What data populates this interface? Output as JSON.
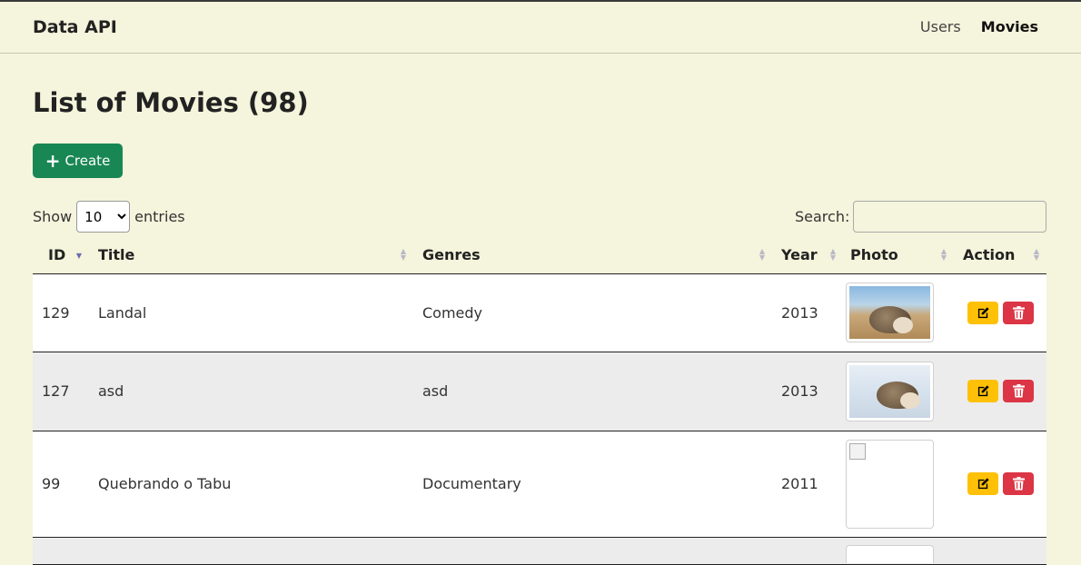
{
  "navbar": {
    "brand": "Data API",
    "links": [
      {
        "label": "Users",
        "active": false
      },
      {
        "label": "Movies",
        "active": true
      }
    ]
  },
  "page": {
    "title": "List of Movies (98)",
    "create_label": "Create"
  },
  "controls": {
    "show_label": "Show",
    "entries_label": "entries",
    "page_size": "10",
    "search_label": "Search:",
    "search_value": ""
  },
  "table": {
    "columns": [
      "ID",
      "Title",
      "Genres",
      "Year",
      "Photo",
      "Action"
    ],
    "sorted_column": "ID",
    "rows": [
      {
        "id": "129",
        "title": "Landal",
        "genres": "Comedy",
        "year": "2013",
        "photo": "hedgehog-sand"
      },
      {
        "id": "127",
        "title": "asd",
        "genres": "asd",
        "year": "2013",
        "photo": "hedgehog-snow"
      },
      {
        "id": "99",
        "title": "Quebrando o Tabu",
        "genres": "Documentary",
        "year": "2011",
        "photo": "broken-image"
      }
    ]
  },
  "colors": {
    "background": "#f5f4dc",
    "create_button": "#198754",
    "edit_button": "#ffc107",
    "delete_button": "#dc3545"
  },
  "icons": {
    "create": "plus-icon",
    "edit": "pencil-square-icon",
    "delete": "trash-icon"
  }
}
